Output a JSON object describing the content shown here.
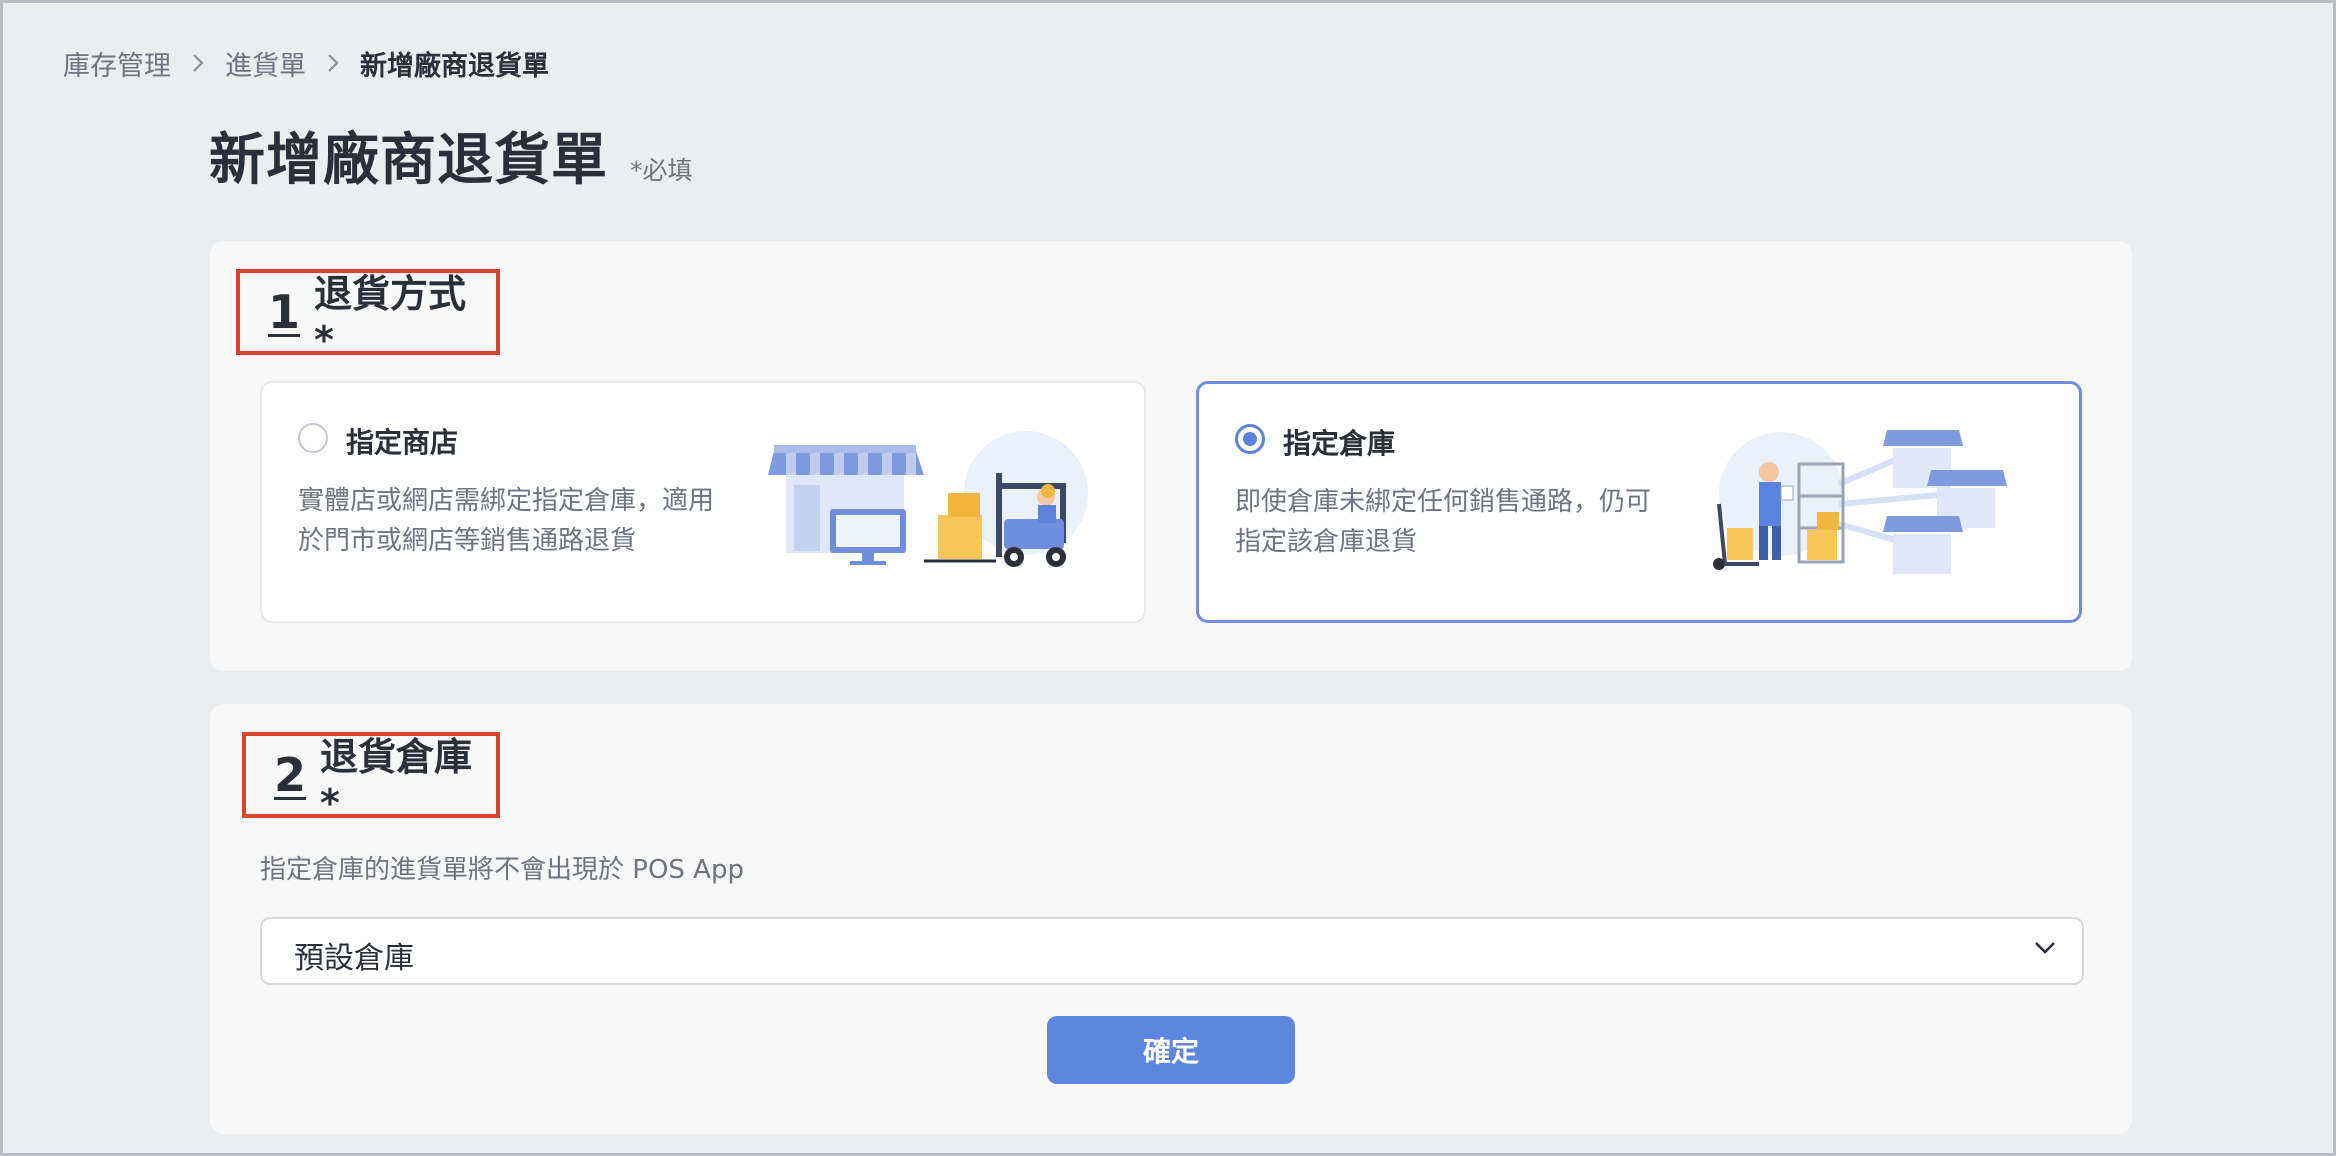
{
  "breadcrumb": {
    "items": [
      "庫存管理",
      "進貨單"
    ],
    "current": "新增廠商退貨單"
  },
  "page": {
    "title": "新增廠商退貨單",
    "required_note": "*必填"
  },
  "section1": {
    "number": "1",
    "label": "退貨方式*",
    "options": [
      {
        "title": "指定商店",
        "desc": "實體店或網店需綁定指定倉庫，適用於門市或網店等銷售通路退貨",
        "selected": false,
        "icon": "storefront-forklift-illustration"
      },
      {
        "title": "指定倉庫",
        "desc": "即使倉庫未綁定任何銷售通路，仍可指定該倉庫退貨",
        "selected": true,
        "icon": "warehouse-stores-illustration"
      }
    ]
  },
  "section2": {
    "number": "2",
    "label": "退貨倉庫*",
    "hint": "指定倉庫的進貨單將不會出現於 POS App",
    "select_value": "預設倉庫",
    "confirm_label": "確定"
  },
  "colors": {
    "accent": "#5e86df",
    "highlight_border": "#d9452c",
    "background": "#ecedef"
  }
}
